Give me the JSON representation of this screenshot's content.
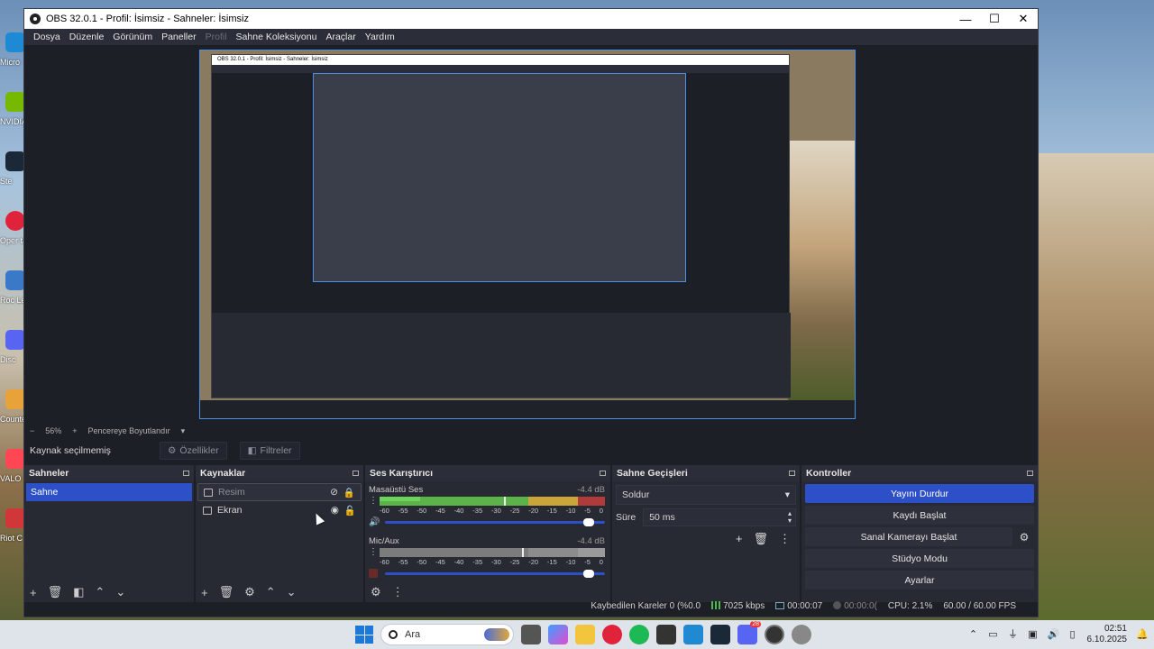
{
  "window": {
    "title": "OBS 32.0.1 - Profil: İsimsiz - Sahneler: İsimsiz",
    "minimize": "—",
    "maximize": "☐",
    "close": "✕"
  },
  "menu": [
    {
      "label": "Dosya",
      "disabled": false
    },
    {
      "label": "Düzenle",
      "disabled": false
    },
    {
      "label": "Görünüm",
      "disabled": false
    },
    {
      "label": "Paneller",
      "disabled": false
    },
    {
      "label": "Profil",
      "disabled": true
    },
    {
      "label": "Sahne Koleksiyonu",
      "disabled": false
    },
    {
      "label": "Araçlar",
      "disabled": false
    },
    {
      "label": "Yardım",
      "disabled": false
    }
  ],
  "nested_preview_title": "OBS 32.0.1 - Profil: İsimsiz - Sahneler: İsimsiz",
  "zoom": {
    "minus": "−",
    "value": "56%",
    "plus": "+",
    "mode": "Pencereye Boyutlandır",
    "caret": "▾"
  },
  "source_toolbar": {
    "status": "Kaynak seçilmemiş",
    "properties": "Özellikler",
    "filters": "Filtreler"
  },
  "scenes": {
    "header": "Sahneler",
    "items": [
      "Sahne"
    ],
    "footer_icons": [
      "add-icon",
      "remove-icon",
      "filter-icon",
      "up-icon",
      "down-icon"
    ]
  },
  "sources": {
    "header": "Kaynaklar",
    "items": [
      {
        "name": "Resim",
        "visible": false,
        "locked": true,
        "icon": "image-icon"
      },
      {
        "name": "Ekran",
        "visible": true,
        "locked": false,
        "icon": "monitor-icon"
      }
    ],
    "footer_icons": [
      "add-icon",
      "remove-icon",
      "gear-icon",
      "up-icon",
      "down-icon"
    ]
  },
  "mixer": {
    "header": "Ses Karıştırıcı",
    "ticks": [
      "-60",
      "-55",
      "-50",
      "-45",
      "-40",
      "-35",
      "-30",
      "-25",
      "-20",
      "-15",
      "-10",
      "-5",
      "0"
    ],
    "tracks": [
      {
        "name": "Masaüstü Ses",
        "db": "-4.4 dB",
        "level": 0.18,
        "peak": 0.55,
        "volume": 0.95,
        "muted": false
      },
      {
        "name": "Mic/Aux",
        "db": "-4.4 dB",
        "level": 0.0,
        "peak": 0.63,
        "volume": 0.95,
        "muted": true
      }
    ]
  },
  "transitions": {
    "header": "Sahne Geçişleri",
    "selected": "Soldur",
    "duration_label": "Süre",
    "duration_value": "50 ms"
  },
  "controls": {
    "header": "Kontroller",
    "start_stream": "Yayını Durdur",
    "start_record": "Kaydı Başlat",
    "virtual_cam": "Sanal Kamerayı Başlat",
    "studio_mode": "Stüdyo Modu",
    "settings": "Ayarlar"
  },
  "status": {
    "dropped": "Kaybedilen Kareler 0 (%0.0",
    "bitrate": "7025 kbps",
    "stream_time": "00:00:07",
    "record_time": "00:00:0(",
    "cpu": "CPU: 2.1%",
    "fps": "60.00 / 60.00 FPS"
  },
  "taskbar": {
    "search_placeholder": "Ara",
    "time": "02:51",
    "date": "6.10.2025",
    "badge": "28"
  },
  "desktop_labels": [
    "Micro",
    "NVIDIA",
    "Ste",
    "Oper tara",
    "Roc Lea",
    "Disc",
    "Counte",
    "VALO",
    "Riot C"
  ],
  "colors": {
    "accent": "#2d50c9",
    "dock_bg": "#272a33",
    "app_bg": "#1d1f26"
  }
}
